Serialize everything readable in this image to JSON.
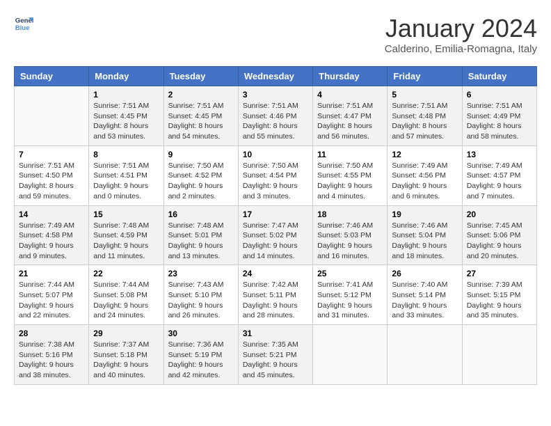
{
  "logo": {
    "line1": "General",
    "line2": "Blue"
  },
  "title": "January 2024",
  "location": "Calderino, Emilia-Romagna, Italy",
  "days_of_week": [
    "Sunday",
    "Monday",
    "Tuesday",
    "Wednesday",
    "Thursday",
    "Friday",
    "Saturday"
  ],
  "weeks": [
    [
      {
        "day": "",
        "info": ""
      },
      {
        "day": "1",
        "info": "Sunrise: 7:51 AM\nSunset: 4:45 PM\nDaylight: 8 hours\nand 53 minutes."
      },
      {
        "day": "2",
        "info": "Sunrise: 7:51 AM\nSunset: 4:45 PM\nDaylight: 8 hours\nand 54 minutes."
      },
      {
        "day": "3",
        "info": "Sunrise: 7:51 AM\nSunset: 4:46 PM\nDaylight: 8 hours\nand 55 minutes."
      },
      {
        "day": "4",
        "info": "Sunrise: 7:51 AM\nSunset: 4:47 PM\nDaylight: 8 hours\nand 56 minutes."
      },
      {
        "day": "5",
        "info": "Sunrise: 7:51 AM\nSunset: 4:48 PM\nDaylight: 8 hours\nand 57 minutes."
      },
      {
        "day": "6",
        "info": "Sunrise: 7:51 AM\nSunset: 4:49 PM\nDaylight: 8 hours\nand 58 minutes."
      }
    ],
    [
      {
        "day": "7",
        "info": "Sunrise: 7:51 AM\nSunset: 4:50 PM\nDaylight: 8 hours\nand 59 minutes."
      },
      {
        "day": "8",
        "info": "Sunrise: 7:51 AM\nSunset: 4:51 PM\nDaylight: 9 hours\nand 0 minutes."
      },
      {
        "day": "9",
        "info": "Sunrise: 7:50 AM\nSunset: 4:52 PM\nDaylight: 9 hours\nand 2 minutes."
      },
      {
        "day": "10",
        "info": "Sunrise: 7:50 AM\nSunset: 4:54 PM\nDaylight: 9 hours\nand 3 minutes."
      },
      {
        "day": "11",
        "info": "Sunrise: 7:50 AM\nSunset: 4:55 PM\nDaylight: 9 hours\nand 4 minutes."
      },
      {
        "day": "12",
        "info": "Sunrise: 7:49 AM\nSunset: 4:56 PM\nDaylight: 9 hours\nand 6 minutes."
      },
      {
        "day": "13",
        "info": "Sunrise: 7:49 AM\nSunset: 4:57 PM\nDaylight: 9 hours\nand 7 minutes."
      }
    ],
    [
      {
        "day": "14",
        "info": "Sunrise: 7:49 AM\nSunset: 4:58 PM\nDaylight: 9 hours\nand 9 minutes."
      },
      {
        "day": "15",
        "info": "Sunrise: 7:48 AM\nSunset: 4:59 PM\nDaylight: 9 hours\nand 11 minutes."
      },
      {
        "day": "16",
        "info": "Sunrise: 7:48 AM\nSunset: 5:01 PM\nDaylight: 9 hours\nand 13 minutes."
      },
      {
        "day": "17",
        "info": "Sunrise: 7:47 AM\nSunset: 5:02 PM\nDaylight: 9 hours\nand 14 minutes."
      },
      {
        "day": "18",
        "info": "Sunrise: 7:46 AM\nSunset: 5:03 PM\nDaylight: 9 hours\nand 16 minutes."
      },
      {
        "day": "19",
        "info": "Sunrise: 7:46 AM\nSunset: 5:04 PM\nDaylight: 9 hours\nand 18 minutes."
      },
      {
        "day": "20",
        "info": "Sunrise: 7:45 AM\nSunset: 5:06 PM\nDaylight: 9 hours\nand 20 minutes."
      }
    ],
    [
      {
        "day": "21",
        "info": "Sunrise: 7:44 AM\nSunset: 5:07 PM\nDaylight: 9 hours\nand 22 minutes."
      },
      {
        "day": "22",
        "info": "Sunrise: 7:44 AM\nSunset: 5:08 PM\nDaylight: 9 hours\nand 24 minutes."
      },
      {
        "day": "23",
        "info": "Sunrise: 7:43 AM\nSunset: 5:10 PM\nDaylight: 9 hours\nand 26 minutes."
      },
      {
        "day": "24",
        "info": "Sunrise: 7:42 AM\nSunset: 5:11 PM\nDaylight: 9 hours\nand 28 minutes."
      },
      {
        "day": "25",
        "info": "Sunrise: 7:41 AM\nSunset: 5:12 PM\nDaylight: 9 hours\nand 31 minutes."
      },
      {
        "day": "26",
        "info": "Sunrise: 7:40 AM\nSunset: 5:14 PM\nDaylight: 9 hours\nand 33 minutes."
      },
      {
        "day": "27",
        "info": "Sunrise: 7:39 AM\nSunset: 5:15 PM\nDaylight: 9 hours\nand 35 minutes."
      }
    ],
    [
      {
        "day": "28",
        "info": "Sunrise: 7:38 AM\nSunset: 5:16 PM\nDaylight: 9 hours\nand 38 minutes."
      },
      {
        "day": "29",
        "info": "Sunrise: 7:37 AM\nSunset: 5:18 PM\nDaylight: 9 hours\nand 40 minutes."
      },
      {
        "day": "30",
        "info": "Sunrise: 7:36 AM\nSunset: 5:19 PM\nDaylight: 9 hours\nand 42 minutes."
      },
      {
        "day": "31",
        "info": "Sunrise: 7:35 AM\nSunset: 5:21 PM\nDaylight: 9 hours\nand 45 minutes."
      },
      {
        "day": "",
        "info": ""
      },
      {
        "day": "",
        "info": ""
      },
      {
        "day": "",
        "info": ""
      }
    ]
  ]
}
